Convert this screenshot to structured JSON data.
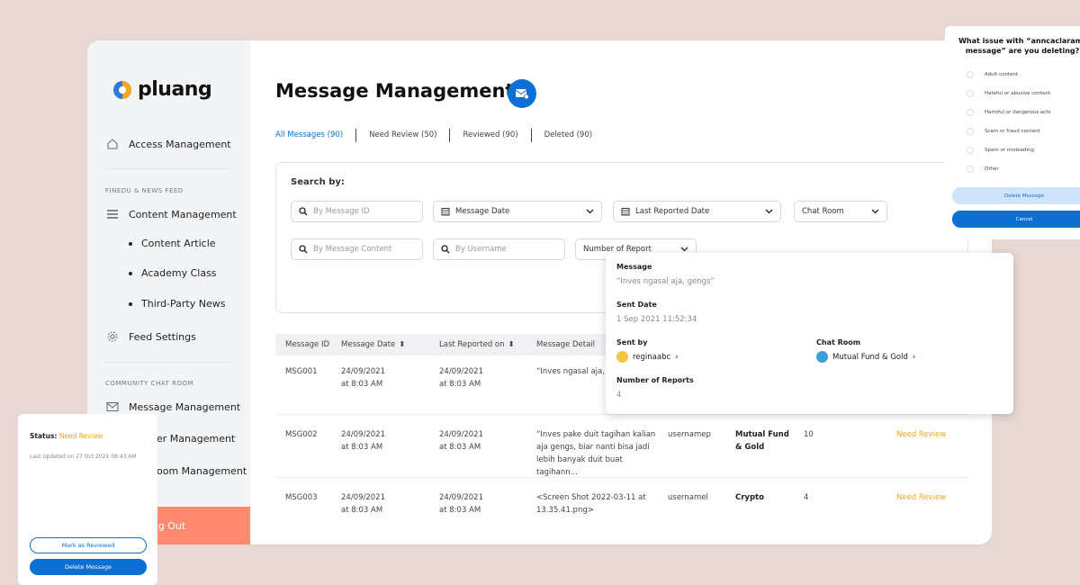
{
  "logo": {
    "text": "pluang"
  },
  "sidebar": {
    "access": "Access Management",
    "section1": "FINEDU & NEWS FEED",
    "content_mgmt": "Content Management",
    "sub1": "Content Article",
    "sub2": "Academy Class",
    "sub3": "Third-Party News",
    "feed": "Feed Settings",
    "section2": "COMMUNITY CHAT ROOM",
    "message_mgmt": "Message Management",
    "user_mgmt_partial": "er Management",
    "room_mgmt_partial": "oom Management",
    "logout_partial": "og Out"
  },
  "page": {
    "title": "Message Management"
  },
  "tabs": [
    "All Messages (90)",
    "Need Review (50)",
    "Reviewed (90)",
    "Deleted (90)"
  ],
  "search": {
    "label": "Search by:",
    "message_id": "By Message ID",
    "message_date": "Message Date",
    "last_reported": "Last Reported Date",
    "chat_room": "Chat Room",
    "message_content": "By Message Content",
    "username": "By Username",
    "number_report": "Number of Report"
  },
  "table": {
    "headers": [
      "Message ID",
      "Message Date",
      "Last Reported on",
      "Message Detail"
    ],
    "rows": [
      {
        "id": "MSG001",
        "date1": "24/09/2021",
        "date2": "at 8:03 AM",
        "rep1": "24/09/2021",
        "rep2": "at 8:03 AM",
        "detail": "“Inves ngasal aja, ",
        "user": "",
        "room": "",
        "count": "",
        "status": ""
      },
      {
        "id": "MSG002",
        "date1": "24/09/2021",
        "date2": "at 8:03 AM",
        "rep1": "24/09/2021",
        "rep2": "at 8:03 AM",
        "detail": "“Inves pake duit tagihan kalian aja gengs, biar nanti bisa jadi lebih banyak duit buat tagihann...",
        "user": "usernamep",
        "room": "Mutual Fund & Gold",
        "count": "10",
        "status": "Need Review"
      },
      {
        "id": "MSG003",
        "date1": "24/09/2021",
        "date2": "at 8:03 AM",
        "rep1": "24/09/2021",
        "rep2": "at 8:03 AM",
        "detail": "<Screen Shot 2022-03-11 at 13.35.41.png>",
        "user": "usernamel",
        "room": "Crypto",
        "count": "4",
        "status": "Need Review"
      }
    ]
  },
  "detail": {
    "message_label": "Message",
    "message": "“Inves ngasal aja, gengs”",
    "sent_date_label": "Sent Date",
    "sent_date": "1 Sep 2021 11:52:34",
    "sent_by_label": "Sent by",
    "sent_by": "reginaabc",
    "chat_room_label": "Chat Room",
    "chat_room": "Mutual Fund & Gold",
    "reports_label": "Number of Reports",
    "reports": "4"
  },
  "status_card": {
    "status_label": "Status:",
    "status_value": "Need Review",
    "updated": "Last Updated on 27 Oct 2021 08:43 AM",
    "mark_reviewed": "Mark as Reviewed",
    "delete": "Delete Message"
  },
  "delete_dialog": {
    "title1": "What issue with “anncaclaramr",
    "title2": "message” are you deleting?",
    "options": [
      "Adult content",
      "Hateful or abusive content",
      "Harmful or dangerous acts",
      "Scam or fraud content",
      "Spam or misleading",
      "Other"
    ],
    "delete": "Delete Message",
    "cancel": "Cancel"
  },
  "colors": {
    "primary": "#0b6fd6",
    "warning": "#f5a623",
    "logout": "#ff8a70",
    "background": "#e8d8d3"
  }
}
